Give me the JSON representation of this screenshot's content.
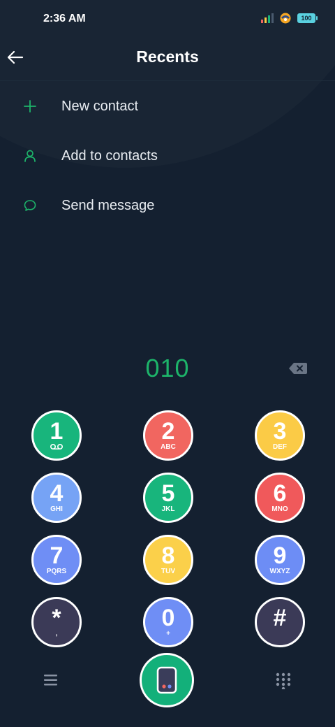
{
  "status_bar": {
    "time": "2:36 AM",
    "battery": "100",
    "icons": [
      "signal-icon",
      "vpn-icon",
      "battery-icon"
    ]
  },
  "header": {
    "title": "Recents",
    "back_icon": "back-arrow-icon"
  },
  "menu": {
    "items": [
      {
        "label": "New contact",
        "icon": "plus-icon"
      },
      {
        "label": "Add to contacts",
        "icon": "person-icon"
      },
      {
        "label": "Send message",
        "icon": "chat-bubble-icon"
      }
    ]
  },
  "dialer": {
    "number": "010",
    "backspace_icon": "backspace-icon",
    "keys": [
      {
        "digit": "1",
        "sub": "",
        "color": "#18b57c"
      },
      {
        "digit": "2",
        "sub": "ABC",
        "color": "#f16660"
      },
      {
        "digit": "3",
        "sub": "DEF",
        "color": "#fbcb46"
      },
      {
        "digit": "4",
        "sub": "GHI",
        "color": "#76a3f5"
      },
      {
        "digit": "5",
        "sub": "JKL",
        "color": "#18b57c"
      },
      {
        "digit": "6",
        "sub": "MNO",
        "color": "#f0595b"
      },
      {
        "digit": "7",
        "sub": "PQRS",
        "color": "#6f8ef5"
      },
      {
        "digit": "8",
        "sub": "TUV",
        "color": "#fbd04a"
      },
      {
        "digit": "9",
        "sub": "WXYZ",
        "color": "#6d8df5"
      },
      {
        "digit": "*",
        "sub": ",",
        "color": "#3b3a57"
      },
      {
        "digit": "0",
        "sub": "+",
        "color": "#6f8ef5"
      },
      {
        "digit": "#",
        "sub": "",
        "color": "#3b3a57"
      }
    ]
  },
  "bottom_bar": {
    "menu_icon": "hamburger-menu-icon",
    "call_icon": "phone-call-icon",
    "keypad_icon": "dialpad-icon"
  },
  "colors": {
    "background": "#142030",
    "accent_green": "#1db46a",
    "call_button": "#13b07a"
  }
}
